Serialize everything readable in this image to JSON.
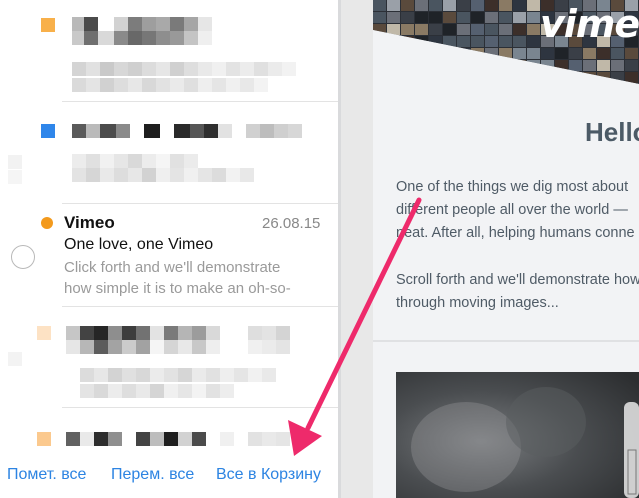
{
  "message_list": {
    "selected_message": {
      "sender": "Vimeo",
      "date": "26.08.15",
      "subject": "One love, one Vimeo",
      "preview_line1": "Click forth and we'll demonstrate",
      "preview_line2": "how simple it is to make an oh-so-"
    }
  },
  "bottom_bar": {
    "mark_all": "Помет. все",
    "move_all": "Перем. все",
    "trash_all": "Все в Корзину"
  },
  "email_preview": {
    "logo_text": "vimeo",
    "greeting": "Hello",
    "paragraph1": [
      "One of the things we dig most about",
      "different people all over the world —",
      "neat. After all, helping humans conne"
    ],
    "paragraph2": [
      "Scroll forth and we'll demonstrate how",
      "through moving images..."
    ]
  },
  "colors": {
    "accent_blue": "#2d84e2",
    "unread_orange": "#f39a1d",
    "arrow_pink": "#ee2a6b",
    "heading_gray": "#4c5a66"
  }
}
